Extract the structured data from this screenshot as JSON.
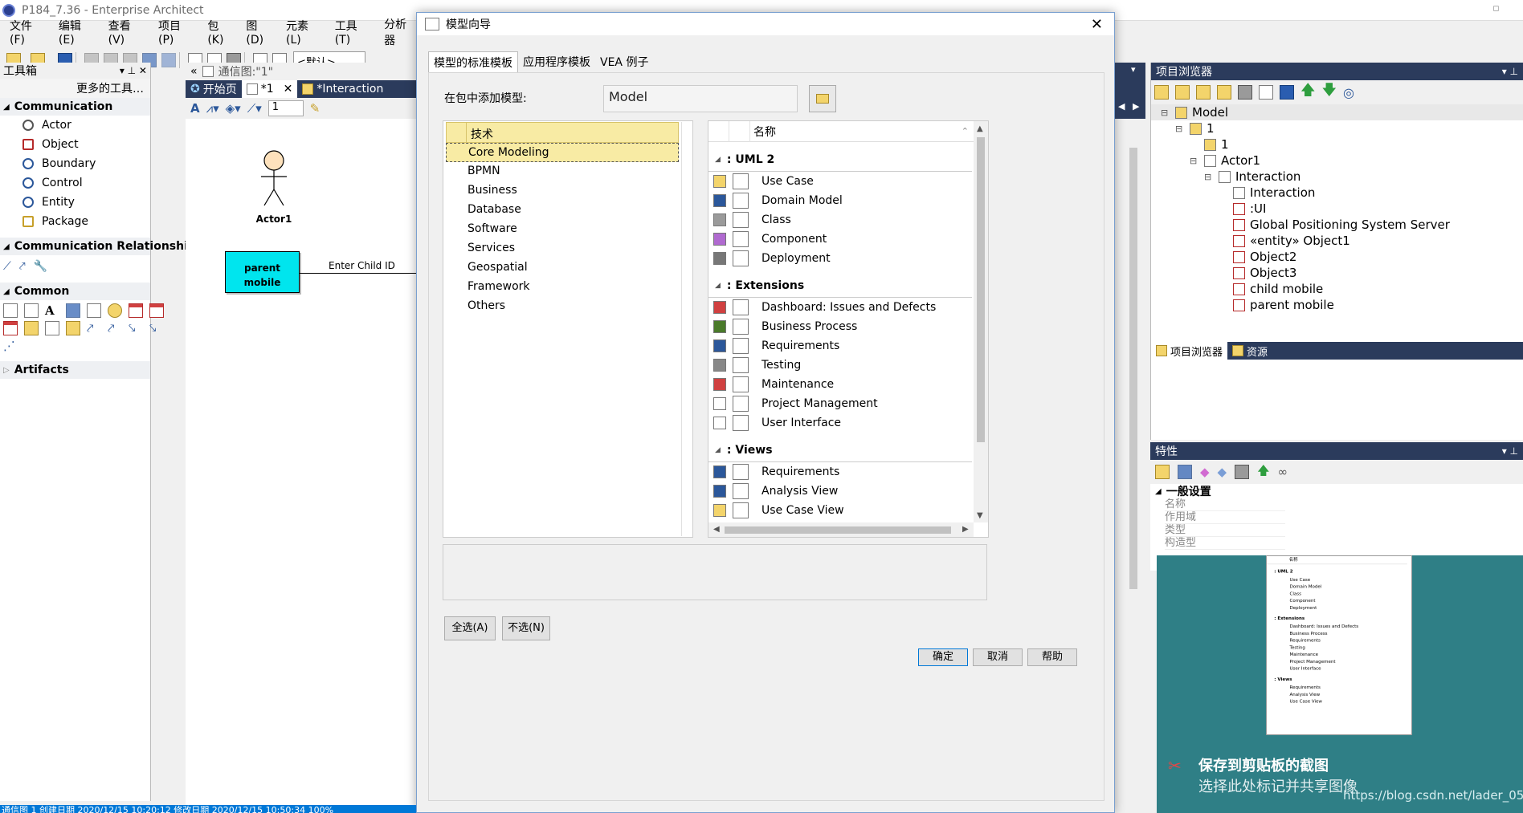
{
  "window": {
    "title": "P184_7.36 - Enterprise Architect"
  },
  "menu": [
    "文件(F)",
    "编辑(E)",
    "查看(V)",
    "项目(P)",
    "包(K)",
    "图(D)",
    "元素(L)",
    "工具(T)",
    "分析器"
  ],
  "toolbar": {
    "default_combo": "<默认>"
  },
  "toolbox": {
    "title": "工具箱",
    "more_tools": "更多的工具…",
    "sections": [
      {
        "label": "Communication",
        "items": [
          {
            "label": "Actor",
            "icon": "actor-icon"
          },
          {
            "label": "Object",
            "icon": "object-icon"
          },
          {
            "label": "Boundary",
            "icon": "boundary-icon"
          },
          {
            "label": "Control",
            "icon": "control-icon"
          },
          {
            "label": "Entity",
            "icon": "entity-icon"
          },
          {
            "label": "Package",
            "icon": "package-icon"
          }
        ]
      },
      {
        "label": "Communication Relationships"
      },
      {
        "label": "Common"
      },
      {
        "label": "Artifacts"
      }
    ]
  },
  "diagram": {
    "label": "通信图:\"1\"",
    "tabs": [
      "开始页",
      "*1",
      "*Interaction"
    ],
    "font_size": "1",
    "actor_label": "Actor1",
    "object_label": "parent mobile",
    "message": "Enter Child ID"
  },
  "dialog": {
    "title": "模型向导",
    "tabs": [
      "模型的标准模板",
      "应用程序模板",
      "VEA 例子"
    ],
    "package_label": "在包中添加模型:",
    "package_value": "Model",
    "tech_header": "技术",
    "technologies": [
      "Core Modeling",
      "BPMN",
      "Business",
      "Database",
      "Software",
      "Services",
      "Geospatial",
      "Framework",
      "Others"
    ],
    "selected_tech": "Core Modeling",
    "name_header": "名称",
    "groups": [
      {
        "label": ": UML 2",
        "items": [
          {
            "label": "Use Case",
            "icon": "use-case-icon"
          },
          {
            "label": "Domain Model",
            "icon": "domain-model-icon"
          },
          {
            "label": "Class",
            "icon": "class-icon"
          },
          {
            "label": "Component",
            "icon": "component-icon"
          },
          {
            "label": "Deployment",
            "icon": "deployment-icon"
          }
        ]
      },
      {
        "label": ": Extensions",
        "items": [
          {
            "label": "Dashboard: Issues and Defects",
            "icon": "dashboard-icon"
          },
          {
            "label": "Business Process",
            "icon": "business-process-icon"
          },
          {
            "label": "Requirements",
            "icon": "requirements-icon"
          },
          {
            "label": "Testing",
            "icon": "testing-icon"
          },
          {
            "label": "Maintenance",
            "icon": "maintenance-icon"
          },
          {
            "label": "Project Management",
            "icon": "project-management-icon"
          },
          {
            "label": "User Interface",
            "icon": "user-interface-icon"
          }
        ]
      },
      {
        "label": ": Views",
        "items": [
          {
            "label": "Requirements",
            "icon": "requirements-icon"
          },
          {
            "label": "Analysis View",
            "icon": "analysis-view-icon"
          },
          {
            "label": "Use Case View",
            "icon": "use-case-view-icon"
          }
        ]
      }
    ],
    "select_all": "全选(A)",
    "select_none": "不选(N)",
    "ok": "确定",
    "cancel": "取消",
    "help": "帮助"
  },
  "project_browser": {
    "title": "项目浏览器",
    "tree": [
      {
        "label": "Model",
        "level": 0
      },
      {
        "label": "1",
        "level": 1
      },
      {
        "label": "1",
        "level": 2
      },
      {
        "label": "Actor1",
        "level": 2
      },
      {
        "label": "Interaction",
        "level": 3
      },
      {
        "label": "Interaction",
        "level": 4
      },
      {
        "label": ":UI",
        "level": 4
      },
      {
        "label": "Global Positioning System Server",
        "level": 4
      },
      {
        "label": "«entity» Object1",
        "level": 4
      },
      {
        "label": "Object2",
        "level": 4
      },
      {
        "label": "Object3",
        "level": 4
      },
      {
        "label": "child mobile",
        "level": 4
      },
      {
        "label": "parent mobile",
        "level": 4
      }
    ],
    "bottom_tabs": [
      "项目浏览器",
      "资源"
    ]
  },
  "properties": {
    "title": "特性",
    "section": "一般设置",
    "rows": [
      "名称",
      "作用域",
      "类型",
      "构造型"
    ]
  },
  "notification": {
    "title": "保存到剪贴板的截图",
    "subtitle": "选择此处标记并共享图像",
    "preview_header": "名称",
    "preview_groups": [
      {
        "label": ": UML 2",
        "items": [
          "Use Case",
          "Domain Model",
          "Class",
          "Component",
          "Deployment"
        ]
      },
      {
        "label": ": Extensions",
        "items": [
          "Dashboard: Issues and Defects",
          "Business Process",
          "Requirements",
          "Testing",
          "Maintenance",
          "Project Management",
          "User Interface"
        ]
      },
      {
        "label": ": Views",
        "items": [
          "Requirements",
          "Analysis View",
          "Use Case View"
        ]
      }
    ]
  },
  "watermark": "https://blog.csdn.net/lader_05",
  "statusbar": {
    "text": "通信图 1 创建日期 2020/12/15 10:20:12 修改日期 2020/12/15 10:50:34 100%"
  },
  "colors": {
    "accent": "#2b579a",
    "selection": "#f8eba4",
    "object_fill": "#00e5ee",
    "actor_fill": "#fde1bc",
    "notification": "#2f7f86"
  }
}
